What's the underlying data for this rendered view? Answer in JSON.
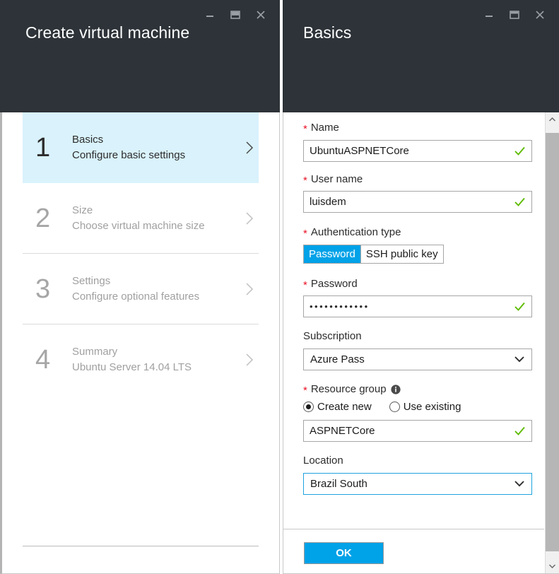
{
  "left_panel": {
    "title": "Create virtual machine",
    "window_controls": [
      {
        "name": "minimize",
        "glyph": "minimize-icon"
      },
      {
        "name": "restore",
        "glyph": "restore-icon"
      },
      {
        "name": "close",
        "glyph": "close-icon"
      }
    ],
    "steps": [
      {
        "number": "1",
        "title": "Basics",
        "subtitle": "Configure basic settings",
        "state": "active"
      },
      {
        "number": "2",
        "title": "Size",
        "subtitle": "Choose virtual machine size",
        "state": "muted"
      },
      {
        "number": "3",
        "title": "Settings",
        "subtitle": "Configure optional features",
        "state": "muted"
      },
      {
        "number": "4",
        "title": "Summary",
        "subtitle": "Ubuntu Server 14.04 LTS",
        "state": "muted"
      }
    ]
  },
  "right_panel": {
    "title": "Basics",
    "window_controls": [
      {
        "name": "minimize",
        "glyph": "minimize-icon"
      },
      {
        "name": "restore",
        "glyph": "restore-icon"
      },
      {
        "name": "close",
        "glyph": "close-icon"
      }
    ],
    "form": {
      "name": {
        "label": "Name",
        "required": true,
        "value": "UbuntuASPNETCore",
        "valid": true
      },
      "user_name": {
        "label": "User name",
        "required": true,
        "value": "luisdem",
        "valid": true
      },
      "auth_type": {
        "label": "Authentication type",
        "required": true,
        "options": [
          "Password",
          "SSH public key"
        ],
        "selected": "Password"
      },
      "password": {
        "label": "Password",
        "required": true,
        "value": "••••••••••••",
        "valid": true
      },
      "subscription": {
        "label": "Subscription",
        "required": false,
        "value": "Azure Pass",
        "options": [
          "Azure Pass"
        ]
      },
      "resource_group": {
        "label": "Resource group",
        "required": true,
        "has_info_icon": true,
        "radio_options": [
          "Create new",
          "Use existing"
        ],
        "radio_selected": "Create new",
        "value": "ASPNETCore",
        "valid": true
      },
      "location": {
        "label": "Location",
        "required": false,
        "value": "Brazil South",
        "options": [
          "Brazil South"
        ],
        "focused": true
      }
    },
    "footer": {
      "ok_label": "OK"
    },
    "scrollbar": {
      "up_arrow": "chevron-up-icon",
      "down_arrow": "chevron-down-icon"
    }
  },
  "colors": {
    "titlebar_bg": "#2d3338",
    "accent_blue": "#00a2e8",
    "active_step_bg": "#d9f2fb",
    "required_red": "#e81123",
    "valid_green": "#5dbb00",
    "focus_border": "#1fa3e0"
  }
}
